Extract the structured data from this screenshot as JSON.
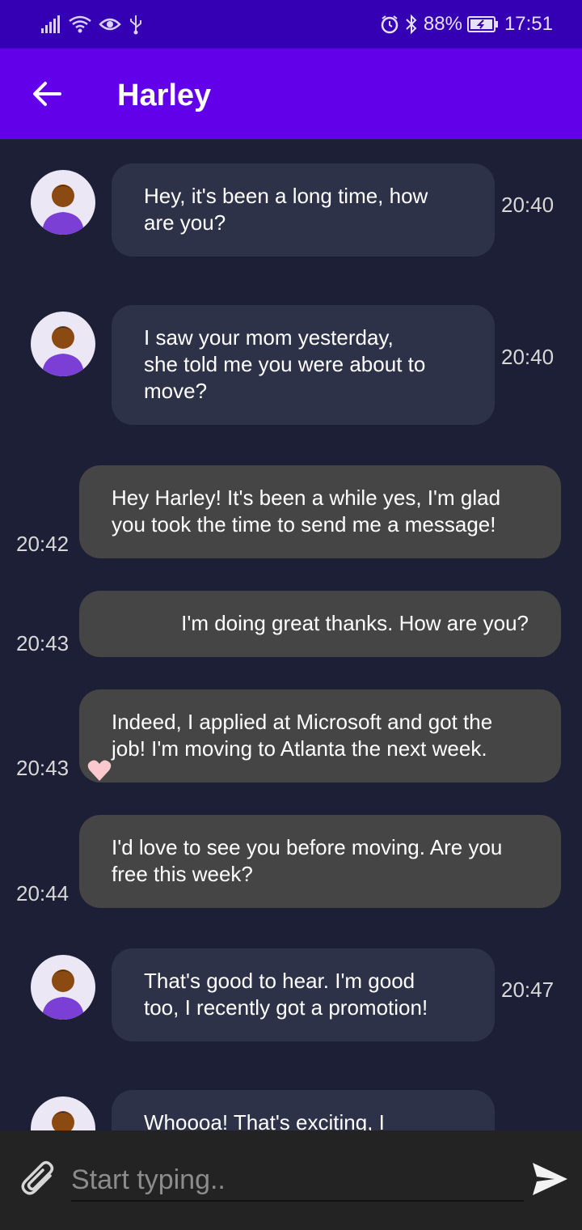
{
  "status_bar": {
    "battery": "88%",
    "time": "17:51"
  },
  "app_bar": {
    "title": "Harley"
  },
  "messages": [
    {
      "direction": "in",
      "lines": [
        "Hey, it's been a long time, how",
        "are you?"
      ],
      "time": "20:40"
    },
    {
      "direction": "in",
      "lines": [
        "I saw your mom yesterday,",
        "she told me you were about to",
        "move?"
      ],
      "time": "20:40"
    },
    {
      "direction": "out",
      "lines": [
        "Hey Harley! It's been a while yes, I'm glad",
        "you took the time to send me a message!"
      ],
      "time": "20:42"
    },
    {
      "direction": "out",
      "lines": [
        "I'm doing great thanks. How are you?"
      ],
      "time": "20:43"
    },
    {
      "direction": "out",
      "lines": [
        "Indeed, I applied at Microsoft and got the",
        "job! I'm moving to Atlanta the next week."
      ],
      "time": "20:43",
      "reaction": "heart"
    },
    {
      "direction": "out",
      "lines": [
        "I'd love to see you before moving. Are you",
        "free this week?"
      ],
      "time": "20:44"
    },
    {
      "direction": "in",
      "lines": [
        "That's good to hear. I'm good",
        "too, I recently got a promotion!"
      ],
      "time": "20:47"
    },
    {
      "direction": "in",
      "lines": [
        "Whoooa! That's exciting, I"
      ],
      "time": ""
    }
  ],
  "composer": {
    "placeholder": "Start typing.."
  },
  "colors": {
    "status_bar": "#3500b3",
    "app_bar": "#6200ea",
    "background": "#1c1f35",
    "incoming_bubble": "#2e3248",
    "outgoing_bubble": "#454545",
    "heart": "#f9c9cf"
  }
}
